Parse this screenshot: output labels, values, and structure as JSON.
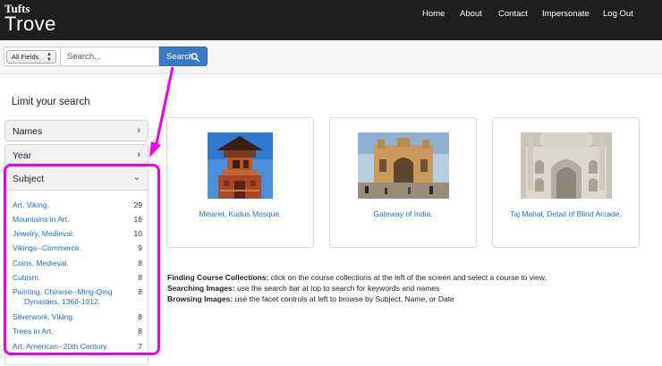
{
  "brand": {
    "top": "Tufts",
    "main": "Trove"
  },
  "nav": {
    "items": [
      {
        "label": "Home"
      },
      {
        "label": "About"
      },
      {
        "label": "Contact"
      },
      {
        "label": "Impersonate"
      },
      {
        "label": "Log Out"
      }
    ]
  },
  "search": {
    "field_select": "All Fields",
    "placeholder": "Search...",
    "button_label": "Search"
  },
  "sidebar": {
    "heading": "Limit your search",
    "facets": [
      {
        "label": "Names"
      },
      {
        "label": "Year"
      }
    ],
    "subject": {
      "label": "Subject",
      "items": [
        {
          "label": "Art, Viking.",
          "count": "29"
        },
        {
          "label": "Mountains in Art.",
          "count": "16"
        },
        {
          "label": "Jewelry, Medieval.",
          "count": "10"
        },
        {
          "label": "Vikings--Commerce.",
          "count": "9"
        },
        {
          "label": "Coins, Medieval.",
          "count": "8"
        },
        {
          "label": "Cubism.",
          "count": "8"
        },
        {
          "label": "Painting, Chinese--Ming-Qing",
          "label2": "Dynasties, 1368-1912.",
          "count": "8"
        },
        {
          "label": "Silverwork, Viking.",
          "count": "8"
        },
        {
          "label": "Trees in Art.",
          "count": "8"
        },
        {
          "label": "Art, American--20th Century.",
          "count": "7"
        }
      ]
    }
  },
  "collections": [
    {
      "caption": "Minaret, Kudus Mosque."
    },
    {
      "caption": "Gateway of India."
    },
    {
      "caption": "Taj Mahal, Detail of Blind Arcade."
    }
  ],
  "help": {
    "finding_title": "Finding Course Collections:",
    "finding_text": " click on the course collections at the left of the screen and select a course to view.",
    "searching_title": "Searching Images:",
    "searching_text": " use the search bar at top to search for keywords and names",
    "browsing_title": "Browsing Images:",
    "browsing_text": " use the facet controls at left to browse by Subject, Name, or Date"
  },
  "colors": {
    "navbar": "#1f1f1f",
    "link": "#2a6bbd",
    "search_button": "#3a7bc8",
    "annotation": "#ee00ee"
  }
}
